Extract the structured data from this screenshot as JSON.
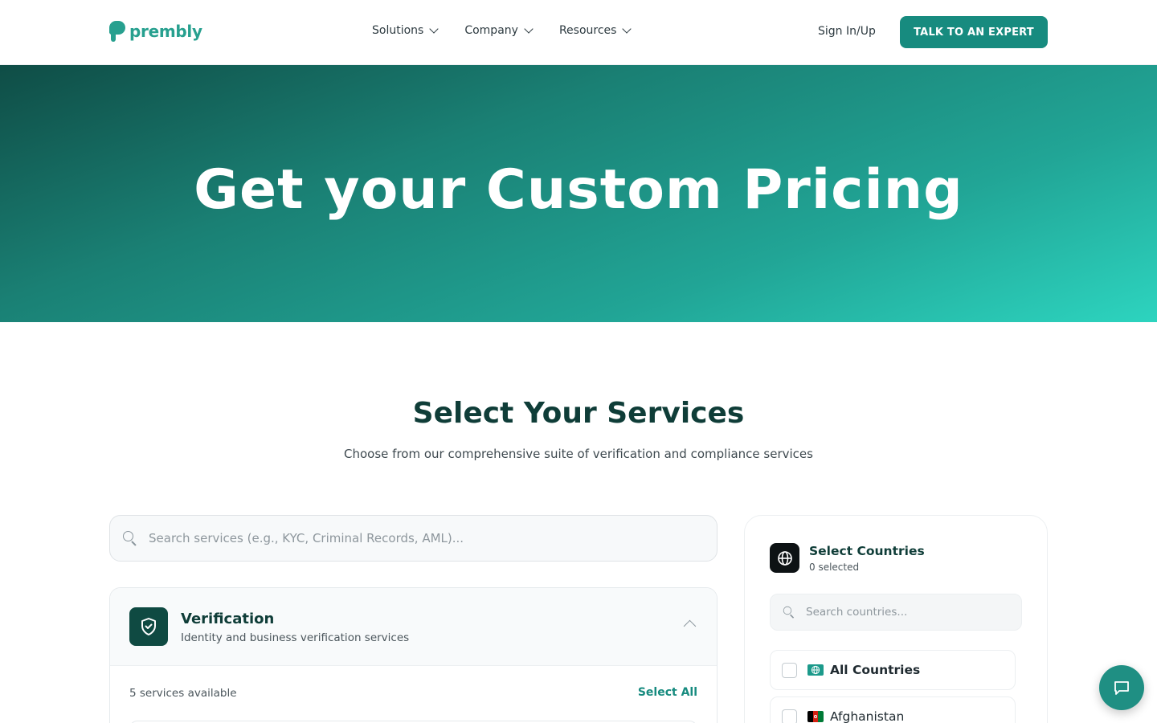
{
  "brand": {
    "name": "prembly",
    "accent": "#178b7f"
  },
  "nav": {
    "items": [
      {
        "label": "Solutions"
      },
      {
        "label": "Company"
      },
      {
        "label": "Resources"
      }
    ],
    "signin": "Sign In/Up",
    "cta": "TALK TO AN EXPERT"
  },
  "hero": {
    "title": "Get your Custom Pricing"
  },
  "services": {
    "title": "Select Your Services",
    "subtitle": "Choose from our comprehensive suite of verification and compliance services",
    "search_placeholder": "Search services (e.g., KYC, Criminal Records, AML)..."
  },
  "verification": {
    "title": "Verification",
    "description": "Identity and business verification services",
    "count": "5 services available",
    "select_all": "Select All",
    "icon": "shield-check-icon"
  },
  "countries": {
    "title": "Select Countries",
    "selected": "0 selected",
    "search_placeholder": "Search countries...",
    "items": [
      {
        "label": "All Countries",
        "flag": "globe-icon",
        "checked": false
      },
      {
        "label": "Afghanistan",
        "flag": "afghanistan-flag",
        "checked": false
      }
    ]
  },
  "chat": {
    "icon": "chat-icon"
  }
}
